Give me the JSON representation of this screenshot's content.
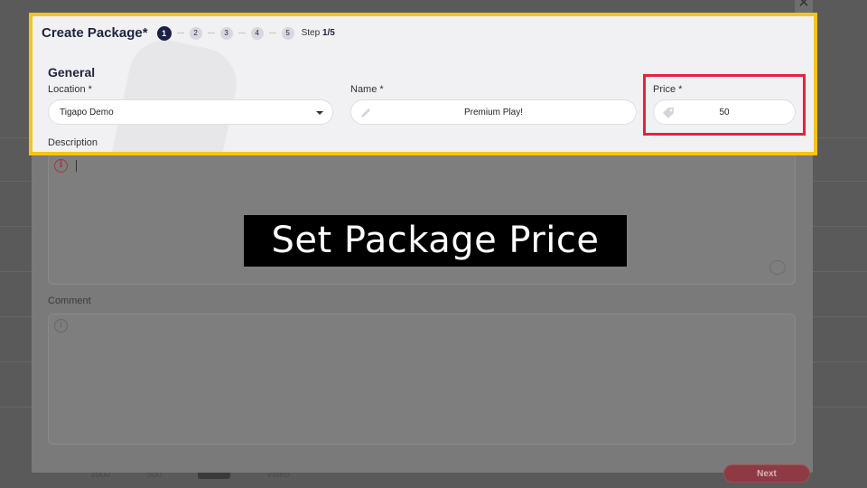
{
  "modal": {
    "title": "Create Package*",
    "steps": [
      "1",
      "2",
      "3",
      "4",
      "5"
    ],
    "step_prefix": "Step",
    "step_progress": "1/5",
    "active_step": 1,
    "section_title": "General",
    "close_glyph": "✕"
  },
  "form": {
    "location": {
      "label": "Location *",
      "value": "Tigapo Demo"
    },
    "name": {
      "label": "Name *",
      "value": "Premium Play!",
      "icon": "pencil-icon"
    },
    "price": {
      "label": "Price *",
      "value": "50",
      "icon": "price-tag-icon"
    },
    "description": {
      "label": "Description"
    },
    "comment": {
      "label": "Comment"
    }
  },
  "footer": {
    "next_label": "Next",
    "bg_values": [
      "1000",
      "500",
      "Video"
    ]
  },
  "caption": "Set Package Price",
  "colors": {
    "highlight": "#f6c416",
    "price_highlight": "#e8213d",
    "navy": "#1c2046",
    "next_button": "#8e3a44"
  }
}
